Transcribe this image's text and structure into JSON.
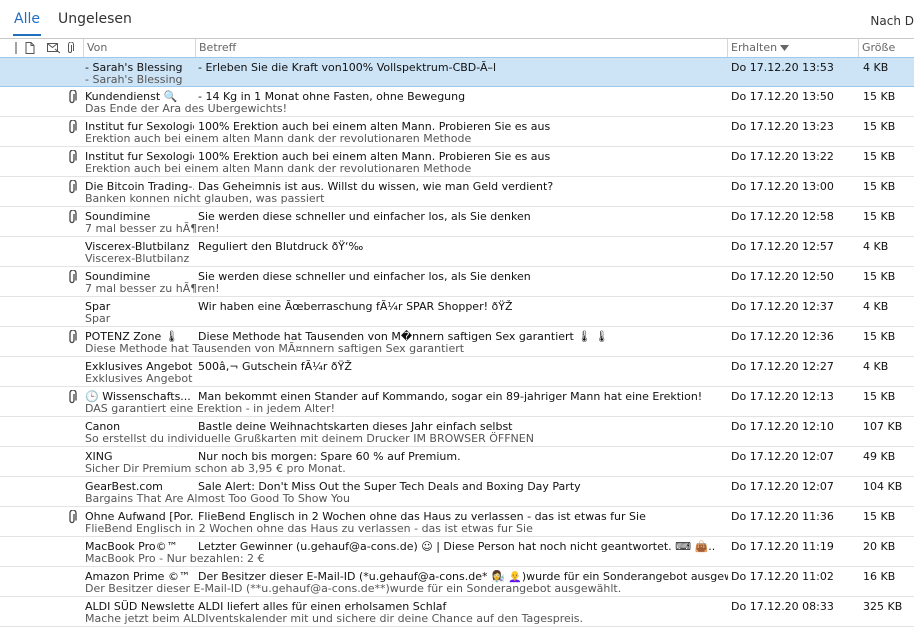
{
  "tabs": {
    "all": "Alle",
    "unread": "Ungelesen",
    "sort_cut": "Nach D"
  },
  "columns": {
    "from": "Von",
    "subject": "Betreff",
    "received": "Erhalten",
    "size": "Größe"
  },
  "icons": {
    "header": [
      "importance-icon",
      "document-icon",
      "reminder-icon",
      "attachment-icon"
    ],
    "row_attachment": "paperclip-icon",
    "sort": "sort-down-icon"
  },
  "colors": {
    "accent": "#1f6fc0",
    "selection": "#cde4f7"
  },
  "messages": [
    {
      "from": "- Sarah's Blessing",
      "subject": "- Erleben Sie die Kraft von100% Vollspektrum-CBD-Ã–l",
      "preview": "- Sarah's Blessing",
      "date": "Do 17.12.20 13:53",
      "size": "4 KB",
      "attachment": false,
      "selected": true
    },
    {
      "from": "Kundendienst 🔍",
      "subject": "- 14 Kg in 1 Monat ohne Fasten, ohne Bewegung",
      "preview": "Das Ende der Ara des Ubergewichts!",
      "date": "Do 17.12.20 13:50",
      "size": "15 KB",
      "attachment": true
    },
    {
      "from": "Institut fur Sexologie",
      "subject": "100% Erektion auch bei einem alten Mann. Probieren Sie es aus",
      "preview": "Erektion auch bei einem alten Mann dank der revolutionaren Methode",
      "date": "Do 17.12.20 13:23",
      "size": "15 KB",
      "attachment": true
    },
    {
      "from": "Institut fur Sexologie",
      "subject": "100% Erektion auch bei einem alten Mann. Probieren Sie es aus",
      "preview": "Erektion auch bei einem alten Mann dank der revolutionaren Methode",
      "date": "Do 17.12.20 13:22",
      "size": "15 KB",
      "attachment": true
    },
    {
      "from": "Die Bitcoin Trading-...",
      "subject": "Das Geheimnis ist aus. Willst du wissen, wie man Geld verdient?",
      "preview": "Banken konnen nicht glauben, was passiert",
      "date": "Do 17.12.20 13:00",
      "size": "15 KB",
      "attachment": true
    },
    {
      "from": "Soundimine",
      "subject": "Sie werden diese schneller und einfacher los, als Sie denken",
      "preview": "7 mal besser zu hÃ¶ren!",
      "date": "Do 17.12.20 12:58",
      "size": "15 KB",
      "attachment": true
    },
    {
      "from": "Viscerex-Blutbilanz",
      "subject": "Reguliert den Blutdruck ðŸ‘‰",
      "preview": "Viscerex-Blutbilanz",
      "date": "Do 17.12.20 12:57",
      "size": "4 KB",
      "attachment": false
    },
    {
      "from": "Soundimine",
      "subject": "Sie werden diese schneller und einfacher los, als Sie denken",
      "preview": "7 mal besser zu hÃ¶ren!",
      "date": "Do 17.12.20 12:50",
      "size": "15 KB",
      "attachment": true
    },
    {
      "from": "Spar",
      "subject": "Wir haben eine Ãœberraschung fÃ¼r SPAR Shopper! ðŸŽ",
      "preview": "Spar",
      "date": "Do 17.12.20 12:37",
      "size": "4 KB",
      "attachment": false
    },
    {
      "from": "POTENZ Zone 🌡",
      "subject": "Diese Methode hat Tausenden von M�nnern saftigen Sex garantiert 🌡 🌡",
      "preview": "Diese Methode hat Tausenden von MÃ¤nnern saftigen Sex garantiert",
      "date": "Do 17.12.20 12:36",
      "size": "15 KB",
      "attachment": true
    },
    {
      "from": "Exklusives Angebot",
      "subject": "500â‚¬ Gutschein fÃ¼r ðŸŽ",
      "preview": "Exklusives Angebot",
      "date": "Do 17.12.20 12:27",
      "size": "4 KB",
      "attachment": false
    },
    {
      "from": "🕒 Wissenschafts...",
      "subject": "Man bekommt einen Stander auf Kommando, sogar ein 89-jahriger Mann hat eine Erektion!",
      "preview": "DAS garantiert eine Erektion - in jedem Alter!",
      "date": "Do 17.12.20 12:13",
      "size": "15 KB",
      "attachment": true
    },
    {
      "from": "Canon",
      "subject": "Bastle deine Weihnachtskarten dieses Jahr einfach selbst",
      "preview": "So erstellst du individuelle Grußkarten mit deinem Drucker            IM BROWSER ÖFFNEN",
      "date": "Do 17.12.20 12:10",
      "size": "107 KB",
      "attachment": false
    },
    {
      "from": "XING",
      "subject": "Nur noch bis morgen: Spare 60 % auf Premium.",
      "preview": "Sicher Dir Premium schon ab 3,95 € pro Monat.",
      "date": "Do 17.12.20 12:07",
      "size": "49 KB",
      "attachment": false
    },
    {
      "from": "GearBest.com",
      "subject": "Sale Alert: Don't Miss Out the Super Tech Deals and Boxing Day Party",
      "preview": "Bargains That Are Almost Too Good To Show You",
      "date": "Do 17.12.20 12:07",
      "size": "104 KB",
      "attachment": false
    },
    {
      "from": "Ohne Aufwand [Por...",
      "subject": "FlieBend Englisch in 2 Wochen ohne das Haus zu verlassen - das ist etwas fur Sie",
      "preview": "FlieBend Englisch in 2 Wochen ohne das Haus zu verlassen - das ist etwas fur Sie",
      "date": "Do 17.12.20 11:36",
      "size": "15 KB",
      "attachment": true
    },
    {
      "from": "MacBook Pro©™",
      "subject": "Letzter Gewinner (u.gehauf@a-cons.de) ☺ | Diese Person hat noch nicht geantwortet. ⌨ 👜..",
      "preview": "MacBook Pro - Nur bezahlen: 2 €",
      "date": "Do 17.12.20 11:19",
      "size": "20 KB",
      "attachment": false
    },
    {
      "from": "Amazon Prime ©™",
      "subject": "Der Besitzer dieser E-Mail-ID (*u.gehauf@a-cons.de* 👩‍🔬 👩‍🦲)wurde für ein Sonderangebot ausgewählt...",
      "preview": "Der Besitzer dieser E-Mail-ID (**u.gehauf@a-cons.de**)wurde für ein Sonderangebot ausgewählt.",
      "date": "Do 17.12.20 11:02",
      "size": "16 KB",
      "attachment": false
    },
    {
      "from": "ALDI SÜD Newsletter",
      "subject": "ALDI liefert alles für einen erholsamen Schlaf",
      "preview": "Mache jetzt beim ALDIventskalender mit und sichere dir deine Chance auf den Tagespreis.",
      "date": "Do 17.12.20 08:33",
      "size": "325 KB",
      "attachment": false
    }
  ]
}
